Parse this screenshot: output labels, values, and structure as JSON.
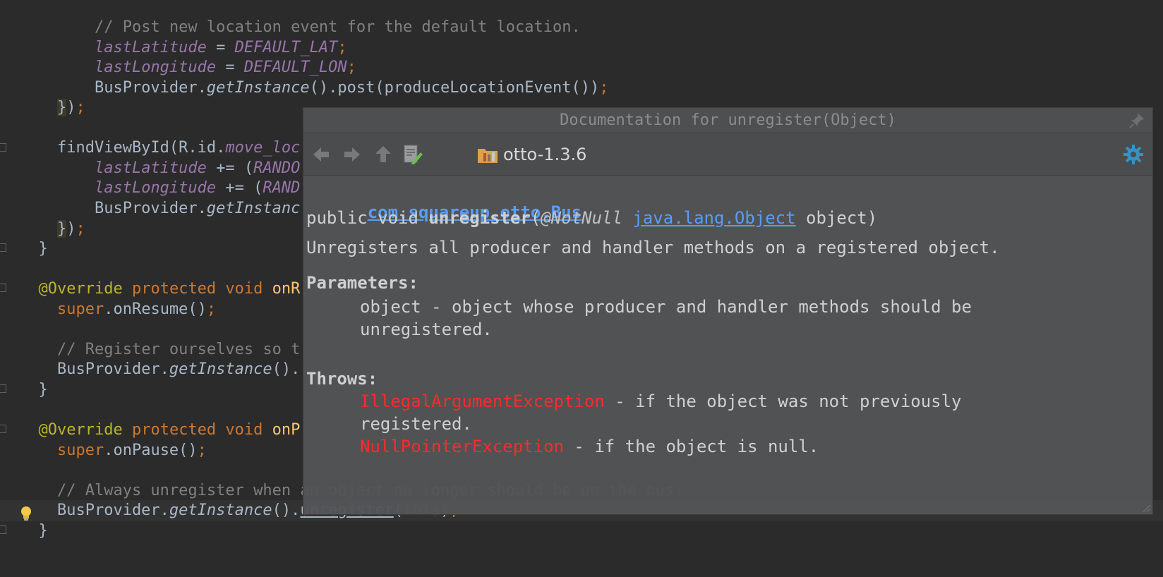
{
  "editor": {
    "lines": [
      [
        {
          "t": "        "
        },
        {
          "t": "// Post new location event for the default location.",
          "c": "comment"
        }
      ],
      [
        {
          "t": "        "
        },
        {
          "t": "lastLatitude",
          "c": "field"
        },
        {
          "t": " = "
        },
        {
          "t": "DEFAULT_LAT",
          "c": "field"
        },
        {
          "t": ";",
          "c": "kw"
        }
      ],
      [
        {
          "t": "        "
        },
        {
          "t": "lastLongitude",
          "c": "field"
        },
        {
          "t": " = "
        },
        {
          "t": "DEFAULT_LON",
          "c": "field"
        },
        {
          "t": ";",
          "c": "kw"
        }
      ],
      [
        {
          "t": "        BusProvider."
        },
        {
          "t": "getInstance",
          "c": "static"
        },
        {
          "t": "().post(produceLocationEvent())"
        },
        {
          "t": ";",
          "c": "kw"
        }
      ],
      [
        {
          "t": "    "
        },
        {
          "t": "}",
          "c": "brace"
        },
        {
          "t": ")"
        },
        {
          "t": ";",
          "c": "kw"
        }
      ],
      [
        {
          "t": ""
        }
      ],
      [
        {
          "t": "    findViewById(R.id."
        },
        {
          "t": "move_loc",
          "c": "field"
        }
      ],
      [
        {
          "t": "        "
        },
        {
          "t": "lastLatitude",
          "c": "field"
        },
        {
          "t": " += ("
        },
        {
          "t": "RANDO",
          "c": "field"
        }
      ],
      [
        {
          "t": "        "
        },
        {
          "t": "lastLongitude",
          "c": "field"
        },
        {
          "t": " += ("
        },
        {
          "t": "RAND",
          "c": "field"
        }
      ],
      [
        {
          "t": "        BusProvider."
        },
        {
          "t": "getInstanc",
          "c": "static"
        }
      ],
      [
        {
          "t": "    "
        },
        {
          "t": "}",
          "c": "brace"
        },
        {
          "t": ")"
        },
        {
          "t": ";",
          "c": "kw"
        }
      ],
      [
        {
          "t": "  }"
        }
      ],
      [
        {
          "t": ""
        }
      ],
      [
        {
          "t": "  "
        },
        {
          "t": "@Override",
          "c": "ann"
        },
        {
          "t": " "
        },
        {
          "t": "protected void",
          "c": "kw"
        },
        {
          "t": " "
        },
        {
          "t": "onR",
          "c": "method"
        }
      ],
      [
        {
          "t": "    "
        },
        {
          "t": "super",
          "c": "kw"
        },
        {
          "t": ".onResume()"
        },
        {
          "t": ";",
          "c": "kw"
        }
      ],
      [
        {
          "t": ""
        }
      ],
      [
        {
          "t": "    "
        },
        {
          "t": "// Register ourselves so t",
          "c": "comment"
        }
      ],
      [
        {
          "t": "    BusProvider."
        },
        {
          "t": "getInstance",
          "c": "static"
        },
        {
          "t": "()."
        }
      ],
      [
        {
          "t": "  }"
        }
      ],
      [
        {
          "t": ""
        }
      ],
      [
        {
          "t": "  "
        },
        {
          "t": "@Override",
          "c": "ann"
        },
        {
          "t": " "
        },
        {
          "t": "protected void",
          "c": "kw"
        },
        {
          "t": " "
        },
        {
          "t": "onP",
          "c": "method"
        }
      ],
      [
        {
          "t": "    "
        },
        {
          "t": "super",
          "c": "kw"
        },
        {
          "t": ".onPause()"
        },
        {
          "t": ";",
          "c": "kw"
        }
      ],
      [
        {
          "t": ""
        }
      ],
      [
        {
          "t": "    "
        },
        {
          "t": "// Always unregister when an object no longer should be on the bus.",
          "c": "comment"
        }
      ],
      [
        {
          "t": "    BusProvider."
        },
        {
          "t": "getInstance",
          "c": "static"
        },
        {
          "t": "()."
        },
        {
          "t": "unregister",
          "c": "under"
        },
        {
          "t": "("
        },
        {
          "t": "this",
          "c": "kw"
        },
        {
          "t": ")"
        },
        {
          "t": ";",
          "c": "kw"
        }
      ],
      [
        {
          "t": "  }"
        }
      ]
    ],
    "caret_line": 24
  },
  "doc_popup": {
    "title": "Documentation for unregister(Object)",
    "toolbar": {
      "back_icon": "back-arrow-icon",
      "forward_icon": "forward-arrow-icon",
      "up_icon": "up-arrow-icon",
      "edit_source_icon": "edit-source-icon",
      "library_icon": "library-folder-icon",
      "library_label": "otto-1.3.6",
      "settings_icon": "gear-icon"
    },
    "class_link": "com.squareup.otto.Bus",
    "signature": {
      "prefix": "public void ",
      "method": "unregister",
      "open": "(",
      "annotation": "@NotNull",
      "space": " ",
      "param_type": "java.lang.Object",
      "suffix": " object)"
    },
    "description": "Unregisters all producer and handler methods on a registered object.",
    "parameters_heading": "Parameters:",
    "param_line1": "object - object whose producer and handler methods should be",
    "param_line2": "unregistered.",
    "throws_heading": "Throws:",
    "throws": [
      {
        "exception": "IllegalArgumentException",
        "desc": " - if the object was not previously"
      },
      {
        "exception": "",
        "desc": "registered."
      },
      {
        "exception": "NullPointerException",
        "desc": " - if the object is null."
      }
    ],
    "colors": {
      "link": "#589df6",
      "exception": "#ff2a2a",
      "settings": "#3592c4"
    }
  }
}
